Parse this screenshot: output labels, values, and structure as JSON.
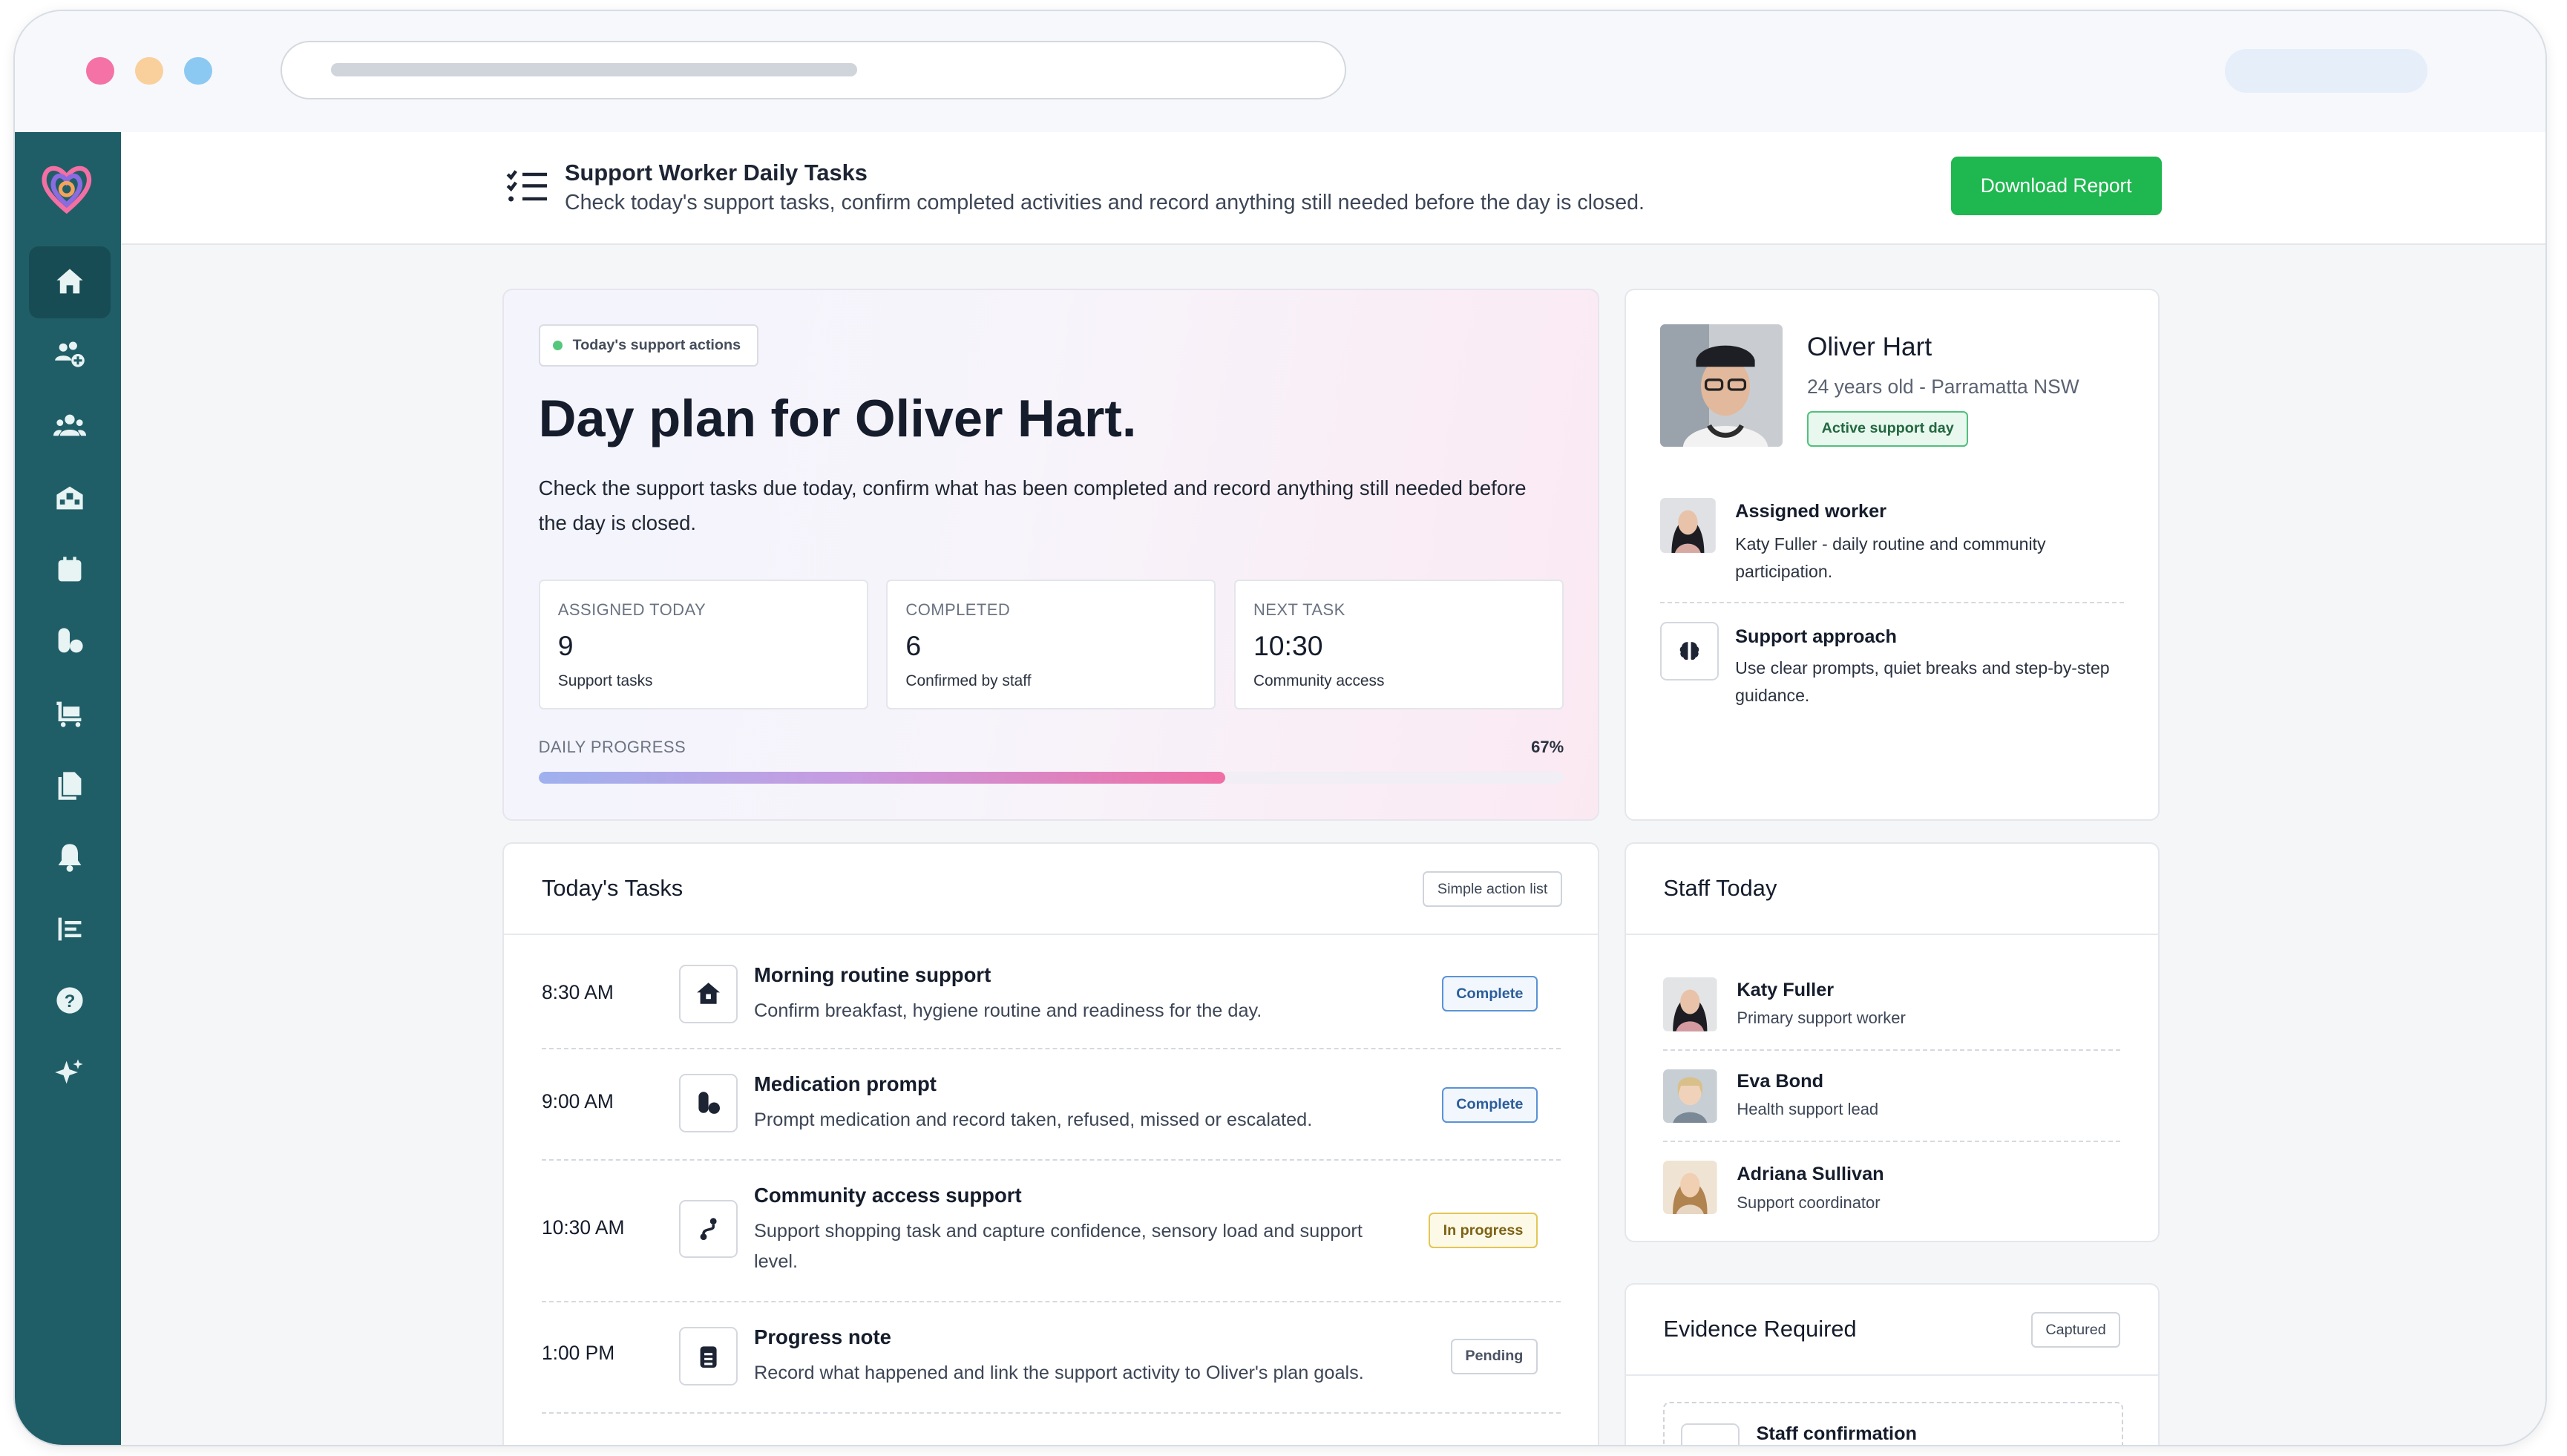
{
  "header": {
    "title": "Support Worker Daily Tasks",
    "subtitle": "Check today's support tasks, confirm completed activities and record anything still needed before the day is closed.",
    "download_label": "Download Report"
  },
  "sidebar": {
    "items": [
      {
        "icon": "home-icon",
        "active": true
      },
      {
        "icon": "add-group-icon"
      },
      {
        "icon": "users-icon"
      },
      {
        "icon": "building-icon"
      },
      {
        "icon": "calendar-icon"
      },
      {
        "icon": "medication-icon"
      },
      {
        "icon": "cart-icon"
      },
      {
        "icon": "documents-icon"
      },
      {
        "icon": "bell-icon"
      },
      {
        "icon": "list-icon"
      },
      {
        "icon": "help-icon"
      },
      {
        "icon": "sparkle-icon"
      }
    ]
  },
  "hero": {
    "tag": "Today's support actions",
    "title": "Day plan for Oliver Hart.",
    "description": "Check the support tasks due today, confirm what has been completed and record anything still needed before the day is closed.",
    "stats": [
      {
        "label": "ASSIGNED TODAY",
        "value": "9",
        "sub": "Support tasks"
      },
      {
        "label": "COMPLETED",
        "value": "6",
        "sub": "Confirmed by staff"
      },
      {
        "label": "NEXT TASK",
        "value": "10:30",
        "sub": "Community access"
      }
    ],
    "progress_label": "DAILY PROGRESS",
    "progress_text": "67%",
    "progress_value": 0.67
  },
  "profile": {
    "name": "Oliver Hart",
    "details": "24 years old - Parramatta NSW",
    "badge": "Active support day",
    "assigned_title": "Assigned worker",
    "assigned_text": "Katy Fuller - daily routine and community participation.",
    "approach_title": "Support approach",
    "approach_text": "Use clear prompts, quiet breaks and step-by-step guidance."
  },
  "tasks": {
    "title": "Today's Tasks",
    "chip": "Simple action list",
    "items": [
      {
        "time": "8:30 AM",
        "icon": "house-icon",
        "title": "Morning routine support",
        "desc": "Confirm breakfast, hygiene routine and readiness for the day.",
        "status": "Complete"
      },
      {
        "time": "9:00 AM",
        "icon": "pills-icon",
        "title": "Medication prompt",
        "desc": "Prompt medication and record taken, refused, missed or escalated.",
        "status": "Complete"
      },
      {
        "time": "10:30 AM",
        "icon": "route-icon",
        "title": "Community access support",
        "desc": "Support shopping task and capture confidence, sensory load and support level.",
        "status": "In progress"
      },
      {
        "time": "1:00 PM",
        "icon": "clipboard-icon",
        "title": "Progress note",
        "desc": "Record what happened and link the support activity to Oliver's plan goals.",
        "status": "Pending"
      }
    ]
  },
  "staff": {
    "title": "Staff Today",
    "members": [
      {
        "name": "Katy Fuller",
        "role": "Primary support worker"
      },
      {
        "name": "Eva Bond",
        "role": "Health support lead"
      },
      {
        "name": "Adriana Sullivan",
        "role": "Support coordinator"
      }
    ]
  },
  "evidence": {
    "title": "Evidence Required",
    "chip": "Captured",
    "item_title": "Staff confirmation"
  },
  "colors": {
    "sidebar": "#205e67",
    "accent_green": "#1fb74f",
    "complete": "#5a93d6",
    "in_progress": "#e3c654"
  }
}
